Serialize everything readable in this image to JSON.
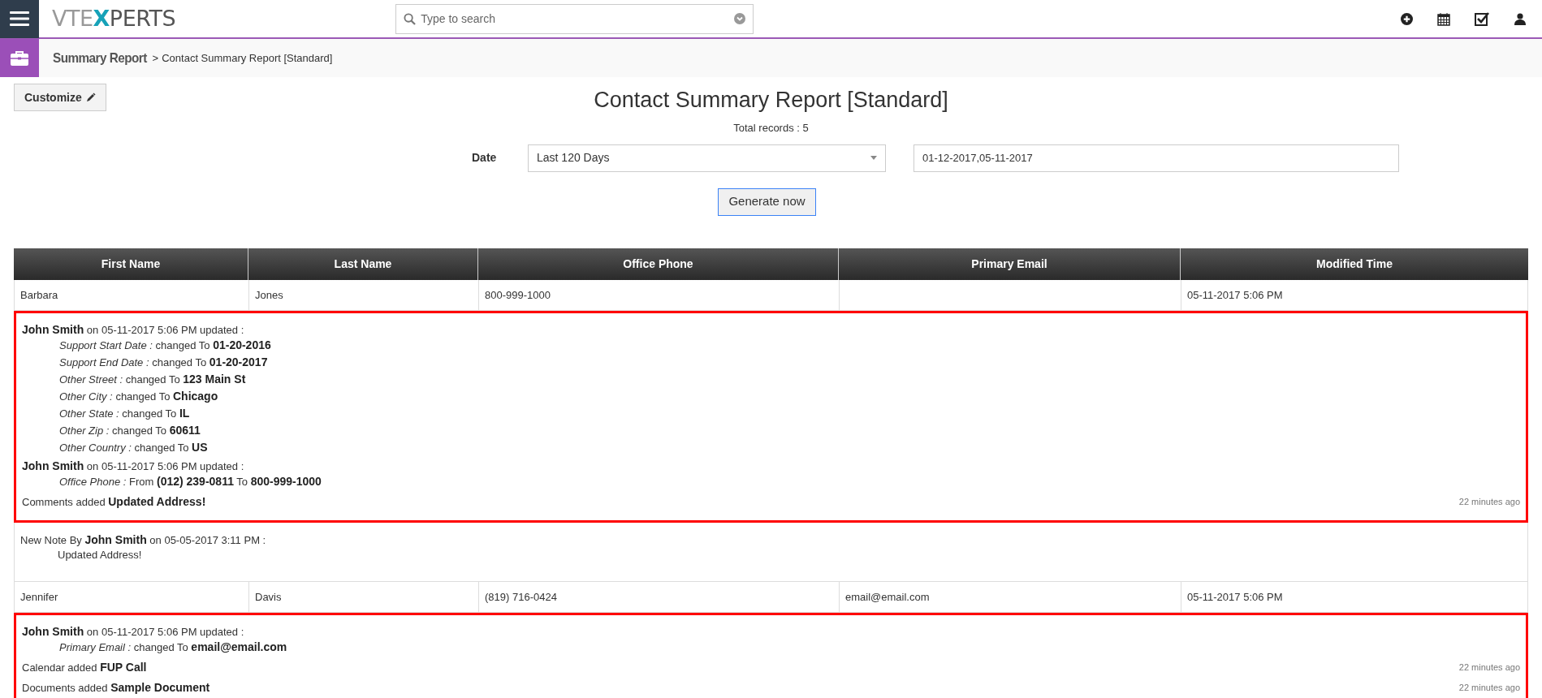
{
  "header": {
    "logo": {
      "before": "VTE",
      "highlight": "X",
      "after": "PERTS"
    },
    "search": {
      "placeholder": "Type to search"
    }
  },
  "breadcrumb": {
    "module": "Summary Report",
    "separator": ">",
    "current": "Contact Summary Report [Standard]"
  },
  "customize_button": "Customize",
  "report": {
    "title": "Contact Summary Report [Standard]",
    "total": "Total records : 5"
  },
  "filter": {
    "label": "Date",
    "select": {
      "value": "Last 120 Days"
    },
    "range": {
      "value": "01-12-2017,05-11-2017"
    },
    "button": "Generate now"
  },
  "table": {
    "columns": [
      "First Name",
      "Last Name",
      "Office Phone",
      "Primary Email",
      "Modified Time"
    ],
    "rows": [
      {
        "cells": [
          "Barbara",
          "Jones",
          "800-999-1000",
          "",
          "05-11-2017 5:06 PM"
        ],
        "activity": {
          "highlighted": true,
          "entries": [
            {
              "kind": "update",
              "header": "**John Smith** on 05-11-2017 5:06 PM updated :",
              "changes": [
                {
                  "field": "Support Start Date :",
                  "text": "changed To **01-20-2016**"
                },
                {
                  "field": "Support End Date :",
                  "text": "changed To **01-20-2017**"
                },
                {
                  "field": "Other Street :",
                  "text": "changed To **123 Main St**"
                },
                {
                  "field": "Other City :",
                  "text": "changed To **Chicago**"
                },
                {
                  "field": "Other State :",
                  "text": "changed To **IL**"
                },
                {
                  "field": "Other Zip :",
                  "text": "changed To **60611**"
                },
                {
                  "field": "Other Country :",
                  "text": "changed To **US**"
                }
              ]
            },
            {
              "kind": "update",
              "header": "**John Smith** on 05-11-2017 5:06 PM updated :",
              "changes": [
                {
                  "field": "Office Phone :",
                  "text": "From **(012) 239-0811** To **800-999-1000**"
                }
              ]
            },
            {
              "kind": "added",
              "text": "Comments added **Updated Address!**",
              "ago": "22 minutes ago"
            }
          ]
        },
        "note": {
          "header": "New Note By **John Smith** on 05-05-2017 3:11 PM :",
          "body": "Updated Address!"
        }
      },
      {
        "cells": [
          "Jennifer",
          "Davis",
          "(819) 716-0424",
          "email@email.com",
          "05-11-2017 5:06 PM"
        ],
        "activity": {
          "highlighted": true,
          "entries": [
            {
              "kind": "update",
              "header": "**John Smith** on 05-11-2017 5:06 PM updated :",
              "changes": [
                {
                  "field": "Primary Email :",
                  "text": "changed To **email@email.com**"
                }
              ]
            },
            {
              "kind": "added",
              "text": "Calendar added **FUP Call**",
              "ago": "22 minutes ago"
            },
            {
              "kind": "added",
              "text": "Documents added **Sample Document**",
              "ago": "22 minutes ago"
            }
          ]
        }
      }
    ]
  }
}
